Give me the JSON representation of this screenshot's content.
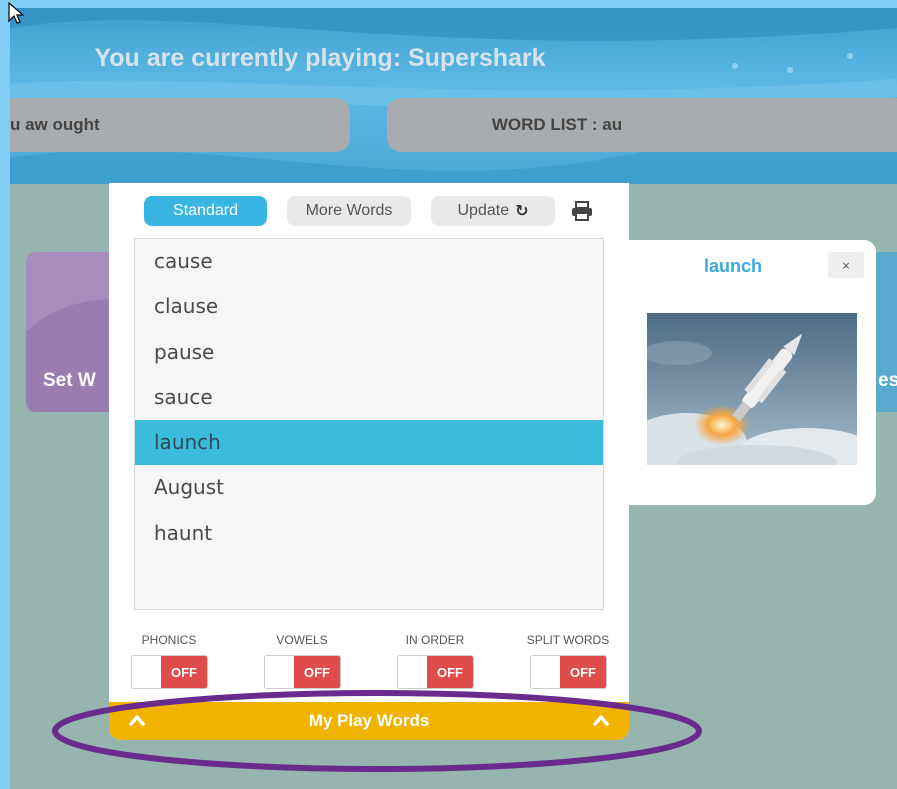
{
  "header": {
    "title": "You are currently playing: Supershark",
    "left_pill": "u aw ought",
    "word_list_label": "WORD LIST : au"
  },
  "background_cards": {
    "left_label": "Set W",
    "right_label": "es"
  },
  "tabs": [
    {
      "label": "Standard",
      "active": true
    },
    {
      "label": "More Words",
      "active": false
    },
    {
      "label": "Update",
      "icon": "refresh-icon",
      "active": false
    }
  ],
  "print_icon": "print-icon",
  "words": [
    "cause",
    "clause",
    "pause",
    "sauce",
    "launch",
    "August",
    "haunt"
  ],
  "selected_word": "launch",
  "toggles": [
    {
      "label": "PHONICS",
      "state": "OFF"
    },
    {
      "label": "VOWELS",
      "state": "OFF"
    },
    {
      "label": "IN ORDER",
      "state": "OFF"
    },
    {
      "label": "SPLIT WORDS",
      "state": "OFF"
    }
  ],
  "my_play_words": {
    "label": "My Play Words",
    "icon": "chevron-up-icon"
  },
  "popup": {
    "title": "launch",
    "close": "×",
    "image": "rocket launch photo"
  },
  "colors": {
    "accent_blue": "#39b5e3",
    "selected_row": "#3bbcdb",
    "toggle_off": "#e04c4c",
    "play_bar": "#f0b400",
    "annotation_oval": "#6a2a8e"
  }
}
